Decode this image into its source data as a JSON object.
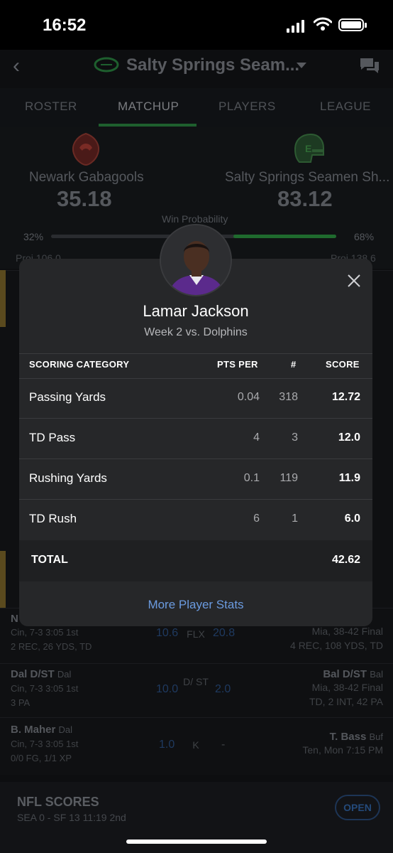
{
  "status": {
    "time": "16:52"
  },
  "header": {
    "title": "Salty Springs Seam...",
    "back_icon": "chevron-left-icon",
    "chat_icon": "chat-icon"
  },
  "tabs": [
    {
      "label": "ROSTER"
    },
    {
      "label": "MATCHUP",
      "active": true
    },
    {
      "label": "PLAYERS"
    },
    {
      "label": "LEAGUE"
    }
  ],
  "matchup": {
    "left": {
      "name": "Newark Gabagools",
      "score": "35.18",
      "pct": "32%",
      "proj": "Proj 106.0"
    },
    "right": {
      "name": "Salty Springs Seamen Sh...",
      "score": "83.12",
      "pct": "68%",
      "proj": "Proj 138.6"
    },
    "win_probability_label": "Win Probability",
    "win_probability_right": 0.68
  },
  "roster_rows": [
    {
      "name": "N",
      "team": "",
      "sub1": "Cin, 7-3 3:05 1st",
      "sub2": "2 REC, 26 YDS, TD",
      "pts": "10.6",
      "slot": "FLX",
      "opp_pts": "20.8",
      "right1": "Mia, 38-42 Final",
      "right2": "4 REC, 108 YDS, TD"
    },
    {
      "name": "Dal D/ST",
      "team": "Dal",
      "sub1": "Cin, 7-3 3:05 1st",
      "sub2": "3 PA",
      "pts": "10.0",
      "slot": "D/ ST",
      "opp_pts": "2.0",
      "right_name": "Bal D/ST",
      "right_team": "Bal",
      "right1": "Mia, 38-42 Final",
      "right2": "TD, 2 INT, 42 PA"
    },
    {
      "name": "B. Maher",
      "team": "Dal",
      "sub1": "Cin, 7-3 3:05 1st",
      "sub2": "0/0 FG, 1/1 XP",
      "pts": "1.0",
      "slot": "K",
      "opp_pts": "-",
      "right_name": "T. Bass",
      "right_team": "Buf",
      "right1": "Ten, Mon 7:15 PM",
      "right2": ""
    }
  ],
  "nfl_scores": {
    "title": "NFL SCORES",
    "sub": "SEA 0 - SF 13   11:19 2nd",
    "open_label": "OPEN"
  },
  "modal": {
    "player_name": "Lamar Jackson",
    "subtitle": "Week 2 vs. Dolphins",
    "close_icon": "close-icon",
    "headers": {
      "category": "SCORING CATEGORY",
      "pts_per": "PTS PER",
      "count": "#",
      "score": "SCORE"
    },
    "rows": [
      {
        "category": "Passing Yards",
        "pts_per": "0.04",
        "count": "318",
        "score": "12.72"
      },
      {
        "category": "TD Pass",
        "pts_per": "4",
        "count": "3",
        "score": "12.0"
      },
      {
        "category": "Rushing Yards",
        "pts_per": "0.1",
        "count": "119",
        "score": "11.9"
      },
      {
        "category": "TD Rush",
        "pts_per": "6",
        "count": "1",
        "score": "6.0"
      }
    ],
    "total_label": "TOTAL",
    "total_value": "42.62",
    "more_link": "More Player Stats"
  },
  "colors": {
    "accent_blue": "#6b9be0",
    "win_green": "#1f6a2e",
    "modal_bg": "#262729"
  }
}
